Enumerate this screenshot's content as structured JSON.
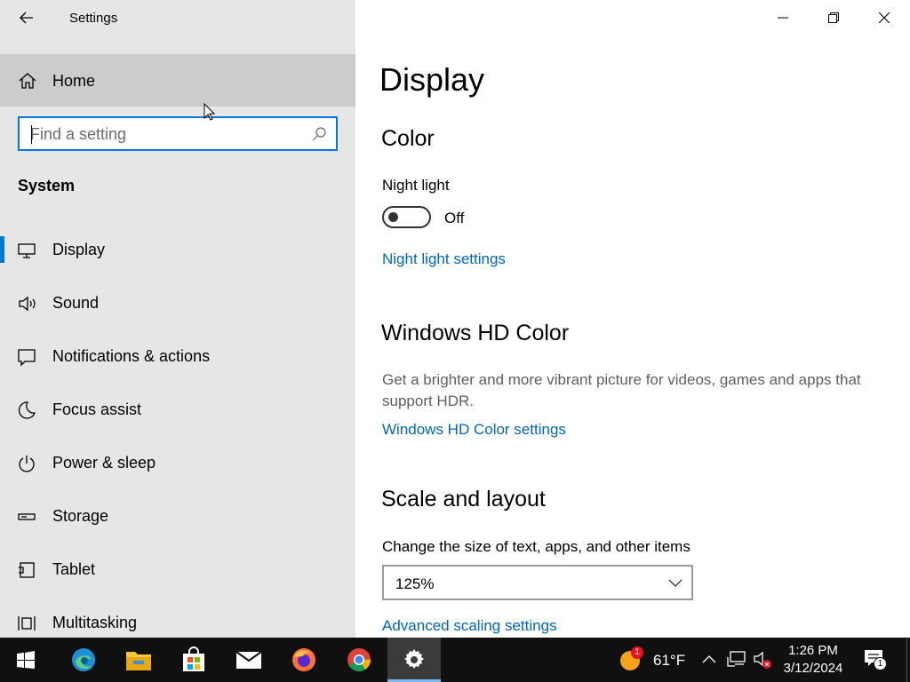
{
  "window": {
    "title": "Settings"
  },
  "sidebar": {
    "home_label": "Home",
    "search_placeholder": "Find a setting",
    "section_title": "System",
    "items": [
      {
        "label": "Display",
        "icon": "monitor-icon",
        "active": true
      },
      {
        "label": "Sound",
        "icon": "speaker-icon"
      },
      {
        "label": "Notifications & actions",
        "icon": "notification-icon"
      },
      {
        "label": "Focus assist",
        "icon": "moon-icon"
      },
      {
        "label": "Power & sleep",
        "icon": "power-icon"
      },
      {
        "label": "Storage",
        "icon": "storage-icon"
      },
      {
        "label": "Tablet",
        "icon": "tablet-icon"
      },
      {
        "label": "Multitasking",
        "icon": "multitasking-icon"
      }
    ]
  },
  "main": {
    "page_title": "Display",
    "color": {
      "heading": "Color",
      "night_light_label": "Night light",
      "night_light_state": "Off",
      "night_light_on": false,
      "night_light_link": "Night light settings"
    },
    "hdr": {
      "heading": "Windows HD Color",
      "description": "Get a brighter and more vibrant picture for videos, games and apps that support HDR.",
      "link": "Windows HD Color settings"
    },
    "scale": {
      "heading": "Scale and layout",
      "size_label": "Change the size of text, apps, and other items",
      "size_value": "125%",
      "advanced_link": "Advanced scaling settings"
    }
  },
  "taskbar": {
    "apps": [
      "start-icon",
      "edge-icon",
      "file-explorer-icon",
      "store-icon",
      "mail-icon",
      "firefox-icon",
      "chrome-icon",
      "settings-icon"
    ],
    "weather_temp": "61°F",
    "weather_badge": "1",
    "time": "1:26 PM",
    "date": "3/12/2024",
    "notification_count": "1"
  },
  "colors": {
    "accent": "#0078d7",
    "link": "#0067b8",
    "sidebar_bg": "#e6e6e6",
    "taskbar_bg": "#101010"
  }
}
